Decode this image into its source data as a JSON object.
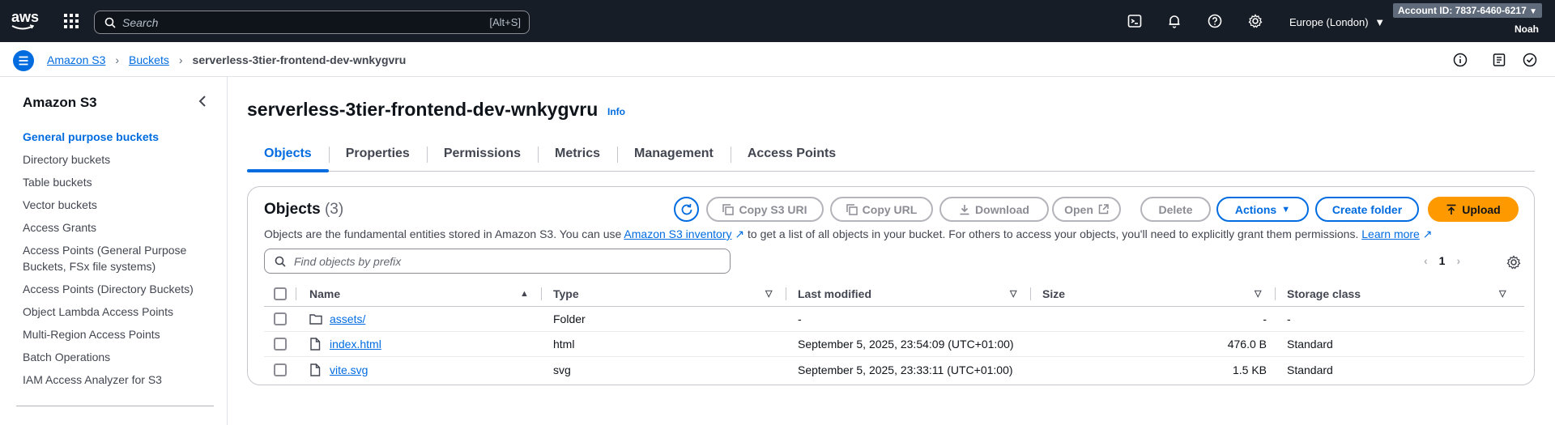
{
  "topnav": {
    "logo": "aws",
    "search_placeholder": "Search",
    "search_shortcut": "[Alt+S]",
    "region": "Europe (London)",
    "account_id": "Account ID: 7837-6460-6217",
    "user": "Noah"
  },
  "breadcrumb": {
    "items": [
      "Amazon S3",
      "Buckets"
    ],
    "current": "serverless-3tier-frontend-dev-wnkygvru"
  },
  "sidebar": {
    "title": "Amazon S3",
    "items": [
      "General purpose buckets",
      "Directory buckets",
      "Table buckets",
      "Vector buckets",
      "Access Grants",
      "Access Points (General Purpose Buckets, FSx file systems)",
      "Access Points (Directory Buckets)",
      "Object Lambda Access Points",
      "Multi-Region Access Points",
      "Batch Operations",
      "IAM Access Analyzer for S3"
    ]
  },
  "page": {
    "title": "serverless-3tier-frontend-dev-wnkygvru",
    "info": "Info",
    "tabs": [
      "Objects",
      "Properties",
      "Permissions",
      "Metrics",
      "Management",
      "Access Points"
    ]
  },
  "objects_panel": {
    "title": "Objects",
    "count": "(3)",
    "desc_pre": "Objects are the fundamental entities stored in Amazon S3. You can use",
    "desc_link1": "Amazon S3 inventory",
    "desc_mid": "to get a list of all objects in your bucket. For others to access your objects, you'll need to explicitly grant them permissions.",
    "desc_link2": "Learn more",
    "buttons": {
      "copy_uri": "Copy S3 URI",
      "copy_url": "Copy URL",
      "download": "Download",
      "open": "Open",
      "delete": "Delete",
      "actions": "Actions",
      "create_folder": "Create folder",
      "upload": "Upload"
    },
    "filter_placeholder": "Find objects by prefix",
    "page_number": "1",
    "columns": [
      "Name",
      "Type",
      "Last modified",
      "Size",
      "Storage class"
    ],
    "rows": [
      {
        "name": "assets/",
        "icon": "folder-icon",
        "type": "Folder",
        "modified": "-",
        "size": "-",
        "storage": "-"
      },
      {
        "name": "index.html",
        "icon": "file-icon",
        "type": "html",
        "modified": "September 5, 2025, 23:54:09 (UTC+01:00)",
        "size": "476.0 B",
        "storage": "Standard"
      },
      {
        "name": "vite.svg",
        "icon": "file-icon",
        "type": "svg",
        "modified": "September 5, 2025, 23:33:11 (UTC+01:00)",
        "size": "1.5 KB",
        "storage": "Standard"
      }
    ]
  },
  "colors": {
    "nav_bg": "#161d26",
    "link": "#006ce0",
    "primary": "#ff9900"
  }
}
